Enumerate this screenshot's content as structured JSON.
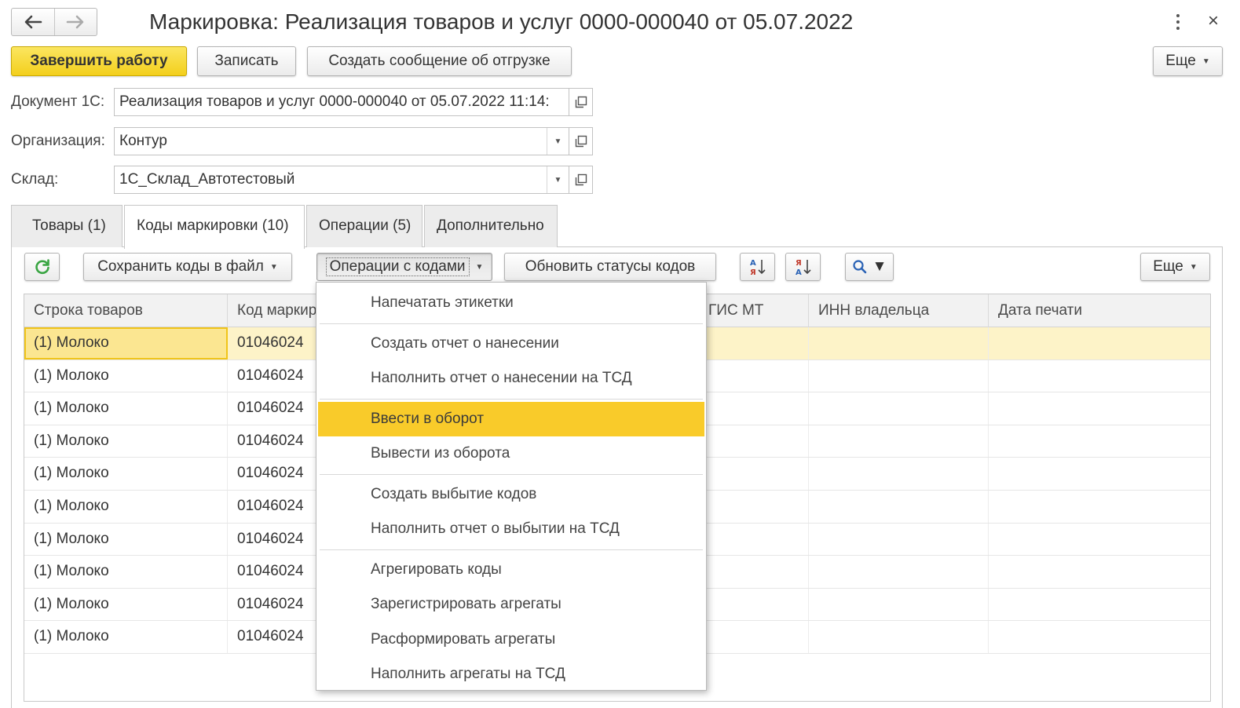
{
  "window": {
    "title": "Маркировка: Реализация товаров и услуг 0000-000040 от 05.07.2022",
    "close": "×"
  },
  "toolbar": {
    "finish": "Завершить работу",
    "save": "Записать",
    "create_msg": "Создать сообщение об отгрузке",
    "more": "Еще"
  },
  "form": {
    "doc_label": "Документ 1С:",
    "doc_value": "Реализация товаров и услуг 0000-000040 от 05.07.2022 11:14:",
    "org_label": "Организация:",
    "org_value": "Контур",
    "wh_label": "Склад:",
    "wh_value": "1С_Склад_Автотестовый"
  },
  "tabs": [
    {
      "label": "Товары (1)"
    },
    {
      "label": "Коды маркировки (10)"
    },
    {
      "label": "Операции (5)"
    },
    {
      "label": "Дополнительно"
    }
  ],
  "codes_toolbar": {
    "save_file": "Сохранить коды в файл",
    "ops": "Операции с кодами",
    "refresh_statuses": "Обновить статусы кодов",
    "more": "Еще"
  },
  "colors": {
    "accent": "#f3cf1c",
    "highlight": "#f9cb2a",
    "selected_row": "#fdf3c8",
    "refresh_green": "#3aa543"
  },
  "table": {
    "columns": [
      "Строка товаров",
      "Код маркир",
      "ГИС МТ",
      "ИНН владельца",
      "Дата печати"
    ],
    "rows": [
      {
        "line": "(1) Молоко",
        "code": "01046024",
        "selected": true
      },
      {
        "line": "(1) Молоко",
        "code": "01046024"
      },
      {
        "line": "(1) Молоко",
        "code": "01046024"
      },
      {
        "line": "(1) Молоко",
        "code": "01046024"
      },
      {
        "line": "(1) Молоко",
        "code": "01046024"
      },
      {
        "line": "(1) Молоко",
        "code": "01046024"
      },
      {
        "line": "(1) Молоко",
        "code": "01046024"
      },
      {
        "line": "(1) Молоко",
        "code": "01046024"
      },
      {
        "line": "(1) Молоко",
        "code": "01046024"
      },
      {
        "line": "(1) Молоко",
        "code": "01046024"
      }
    ]
  },
  "menu": {
    "groups": [
      [
        "Напечатать этикетки"
      ],
      [
        "Создать отчет о нанесении",
        "Наполнить отчет о нанесении на ТСД"
      ],
      [
        "Ввести в оборот",
        "Вывести из оборота"
      ],
      [
        "Создать выбытие кодов",
        "Наполнить отчет о выбытии на ТСД"
      ],
      [
        "Агрегировать коды",
        "Зарегистрировать агрегаты",
        "Расформировать агрегаты",
        "Наполнить агрегаты на ТСД"
      ]
    ],
    "highlighted": "Ввести в оборот"
  }
}
